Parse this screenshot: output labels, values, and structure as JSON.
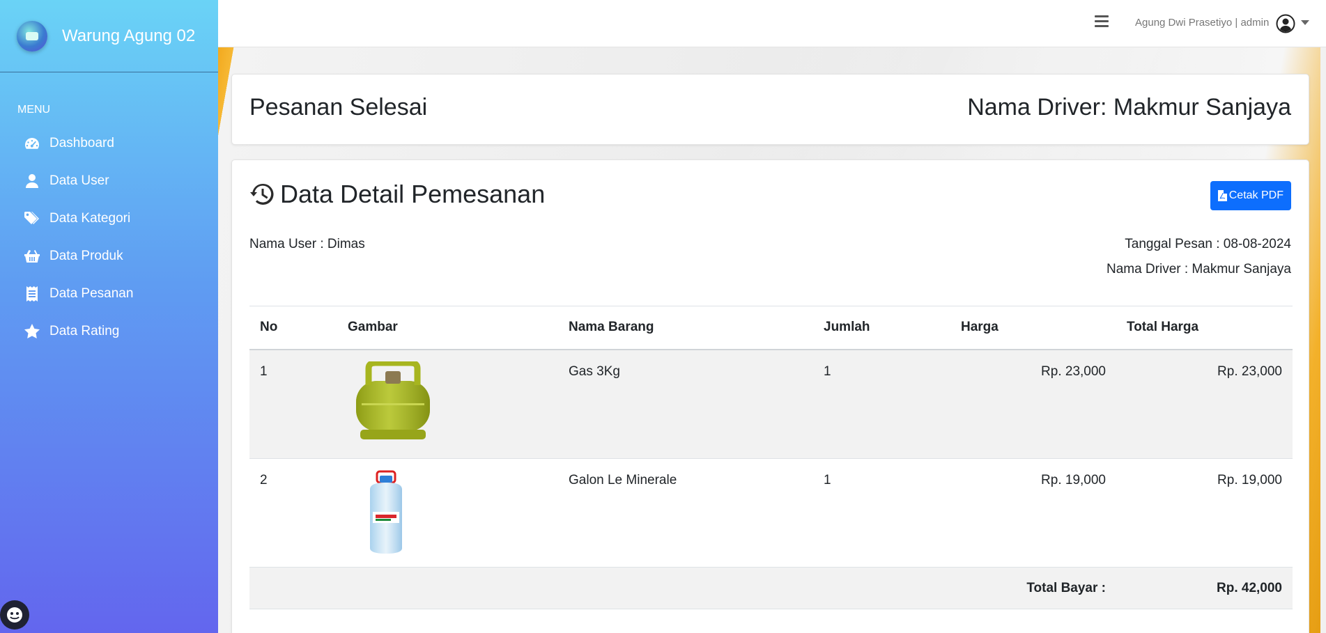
{
  "brand": {
    "name": "Warung Agung 02"
  },
  "sidebar": {
    "heading": "MENU",
    "items": [
      {
        "label": "Dashboard",
        "icon": "gauge-icon"
      },
      {
        "label": "Data User",
        "icon": "user-icon"
      },
      {
        "label": "Data Kategori",
        "icon": "tags-icon"
      },
      {
        "label": "Data Produk",
        "icon": "basket-icon"
      },
      {
        "label": "Data Pesanan",
        "icon": "receipt-icon"
      },
      {
        "label": "Data Rating",
        "icon": "star-icon"
      }
    ]
  },
  "topbar": {
    "user_label": "Agung Dwi Prasetiyo | admin"
  },
  "page_header": {
    "title": "Pesanan Selesai",
    "driver": "Nama Driver: Makmur Sanjaya"
  },
  "detail": {
    "title": "Data Detail Pemesanan",
    "pdf_button": "Cetak PDF",
    "user": "Nama User : Dimas",
    "date": "Tanggal Pesan : 08-08-2024",
    "driver": "Nama Driver : Makmur Sanjaya"
  },
  "table": {
    "headers": [
      "No",
      "Gambar",
      "Nama Barang",
      "Jumlah",
      "Harga",
      "Total Harga"
    ],
    "rows": [
      {
        "no": "1",
        "name": "Gas 3Kg",
        "qty": "1",
        "price": "Rp. 23,000",
        "total": "Rp. 23,000"
      },
      {
        "no": "2",
        "name": "Galon Le Minerale",
        "qty": "1",
        "price": "Rp. 19,000",
        "total": "Rp. 19,000"
      }
    ],
    "total_label": "Total Bayar :",
    "total_value": "Rp. 42,000"
  },
  "colors": {
    "accent": "#0d6efd",
    "sidebar_top": "#6ad3f6",
    "sidebar_bottom": "#6366ee"
  }
}
